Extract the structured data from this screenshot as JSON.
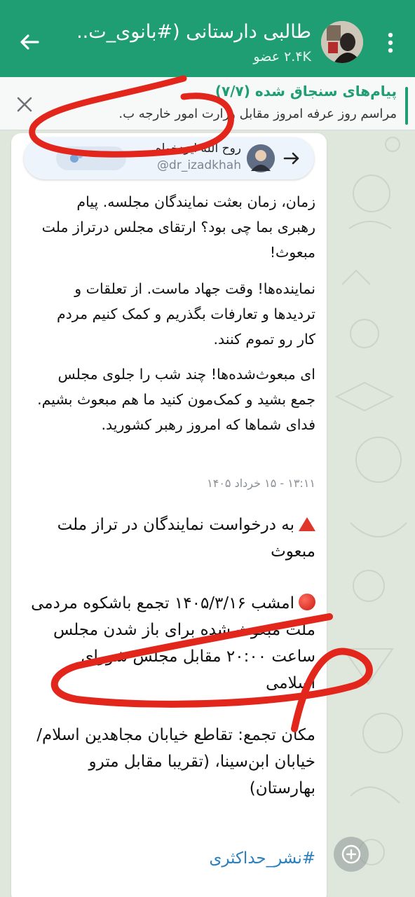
{
  "header": {
    "title": "طالبی دارستانی (#بانوی_ت..",
    "subtitle": "۲.۴K عضو",
    "bg_color": "#1f9e73"
  },
  "pinned": {
    "title": "پیام‌های سنجاق شده (۷/۷)",
    "text": "مراسم روز عرفه امروز مقابل وزارت امور خارجه ب.",
    "accent": "#1f9e73"
  },
  "forward": {
    "name": "روح الله ایزدخواه",
    "handle": "@dr_izadkhah"
  },
  "message": {
    "p1": "زمان، زمان بعثت نمایندگان مجلسه. پیام رهبری بما چی بود؟ ارتقای مجلس درتراز ملت مبعوث!",
    "p2": "نماینده‌ها! وقت جهاد ماست. از تعلقات و تردیدها و تعارفات بگذریم و کمک کنیم مردم کار رو تموم کنند.",
    "p3": "ای مبعوث‌شده‌ها! چند شب را جلوی مجلس جمع بشید و کمک‌مون کنید ما هم مبعوث بشیم. فدای شماها که امروز رهبر کشورید.",
    "timestamp": "۱۳:۱۱ - ۱۵ خرداد ۱۴۰۵",
    "b1": "به درخواست نمایندگان در تراز ملت مبعوث",
    "b2": "امشب ۱۴۰۵/۳/۱۶ تجمع باشکوه مردمی ملت مبعوث شده برای باز شدن مجلس ساعت ۲۰:۰۰ مقابل مجلس شورای اسلامی",
    "b3": "مکان تجمع: تقاطع خیابان مجاهدین اسلام/ خیابان ابن‌سینا، (تقریبا مقابل مترو بهارستان)",
    "hashtag": "#نشر_حداکثری"
  },
  "icons": {
    "back": "arrow-left-icon",
    "menu": "more-vertical-icon",
    "close": "close-icon",
    "forward": "forward-arrow-icon",
    "fab": "scroll-down-icon"
  },
  "colors": {
    "scribble": "#e2261c",
    "link": "#2a7fbf"
  }
}
